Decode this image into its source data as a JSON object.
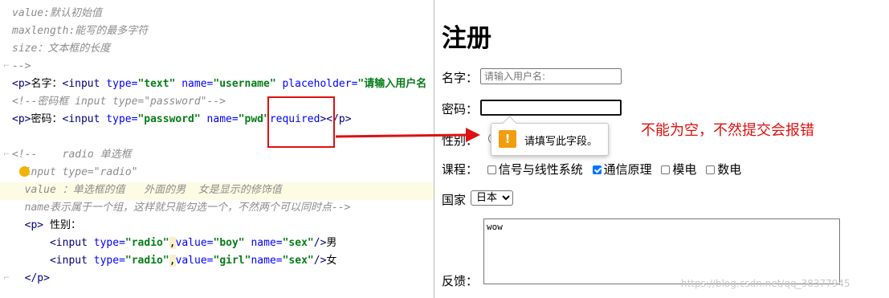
{
  "editor": {
    "lines": [
      {
        "parts": [
          {
            "t": "cm",
            "v": "value:默认初始值"
          }
        ]
      },
      {
        "parts": [
          {
            "t": "cm",
            "v": "maxlength:能写的最多字符"
          }
        ]
      },
      {
        "parts": [
          {
            "t": "cm",
            "v": "size：文本框的长度"
          }
        ]
      },
      {
        "parts": [
          {
            "t": "cm",
            "v": "-->"
          }
        ]
      },
      {
        "parts": [
          {
            "t": "tg",
            "v": "<p>"
          },
          {
            "t": "tx",
            "v": "名字："
          },
          {
            "t": "tg",
            "v": "<input "
          },
          {
            "t": "at",
            "v": "type="
          },
          {
            "t": "sv",
            "v": "\"text\""
          },
          {
            "t": "tx",
            "v": " "
          },
          {
            "t": "at",
            "v": "name="
          },
          {
            "t": "sv",
            "v": "\"username\""
          },
          {
            "t": "tx",
            "v": " "
          },
          {
            "t": "at",
            "v": "placeholder="
          },
          {
            "t": "sv",
            "v": "\"请输入用户名"
          }
        ]
      },
      {
        "parts": [
          {
            "t": "cm",
            "v": "<!--密码框 input type=\"password\"-->"
          }
        ]
      },
      {
        "parts": [
          {
            "t": "tg",
            "v": "<p>"
          },
          {
            "t": "tx",
            "v": "密码："
          },
          {
            "t": "tg",
            "v": "<input "
          },
          {
            "t": "at",
            "v": "type="
          },
          {
            "t": "sv",
            "v": "\"password\""
          },
          {
            "t": "tx",
            "v": " "
          },
          {
            "t": "at",
            "v": "name="
          },
          {
            "t": "sv",
            "v": "\"pwd\""
          },
          {
            "t": "at",
            "v": "required"
          },
          {
            "t": "tg",
            "v": ">"
          },
          {
            "t": "tg",
            "v": "</p>"
          }
        ]
      },
      {
        "parts": [
          {
            "t": "tx",
            "v": ""
          }
        ]
      },
      {
        "parts": [
          {
            "t": "cm",
            "v": "<!--    radio 单选框"
          }
        ]
      },
      {
        "parts": [
          {
            "t": "cm",
            "v": "  input type=\"radio\""
          }
        ]
      },
      {
        "parts": [
          {
            "t": "cm",
            "v": "  value ：单选框的值   外面的男  女是显示的修饰值"
          }
        ]
      },
      {
        "parts": [
          {
            "t": "cm",
            "v": "  name表示属于一个组，这样就只能勾选一个，不然两个可以同时点-->"
          }
        ]
      },
      {
        "parts": [
          {
            "t": "tg",
            "v": "  <p>"
          },
          {
            "t": "tx",
            "v": " 性别："
          }
        ]
      },
      {
        "parts": [
          {
            "t": "tx",
            "v": "      "
          },
          {
            "t": "tg",
            "v": "<input "
          },
          {
            "t": "at",
            "v": "type="
          },
          {
            "t": "sv",
            "v": "\"radio\""
          },
          {
            "t": "wv",
            "v": ","
          },
          {
            "t": "at",
            "v": "value="
          },
          {
            "t": "sv",
            "v": "\"boy\""
          },
          {
            "t": "tx",
            "v": " "
          },
          {
            "t": "at",
            "v": "name="
          },
          {
            "t": "sv",
            "v": "\"sex\""
          },
          {
            "t": "tg",
            "v": "/>"
          },
          {
            "t": "tx",
            "v": "男"
          }
        ]
      },
      {
        "parts": [
          {
            "t": "tx",
            "v": "      "
          },
          {
            "t": "tg",
            "v": "<input "
          },
          {
            "t": "at",
            "v": "type="
          },
          {
            "t": "sv",
            "v": "\"radio\""
          },
          {
            "t": "wv",
            "v": ","
          },
          {
            "t": "at",
            "v": "value="
          },
          {
            "t": "sv",
            "v": "\"girl\""
          },
          {
            "t": "at",
            "v": "name="
          },
          {
            "t": "sv",
            "v": "\"sex\""
          },
          {
            "t": "tg",
            "v": "/>"
          },
          {
            "t": "tx",
            "v": "女"
          }
        ]
      },
      {
        "parts": [
          {
            "t": "tg",
            "v": "  </p>"
          }
        ]
      }
    ]
  },
  "browser": {
    "title": "注册",
    "name_label": "名字：",
    "name_placeholder": "请输入用户名:",
    "pwd_label": "密码：",
    "gender_label": "性别：",
    "courses_label": "课程：",
    "courses": [
      {
        "label": "信号与线性系统",
        "checked": false
      },
      {
        "label": "通信原理",
        "checked": true
      },
      {
        "label": "模电",
        "checked": false
      },
      {
        "label": "数电",
        "checked": false
      }
    ],
    "country_label": "国家",
    "country_selected": "日本",
    "feedback_label": "反馈：",
    "feedback_value": "wow"
  },
  "tooltip": {
    "icon": "warning-icon",
    "text": "请填写此字段。"
  },
  "annotation": {
    "text": "不能为空，不然提交会报错",
    "color": "#e01010"
  },
  "watermark": "https://blog.csdn.net/qq_38377945"
}
